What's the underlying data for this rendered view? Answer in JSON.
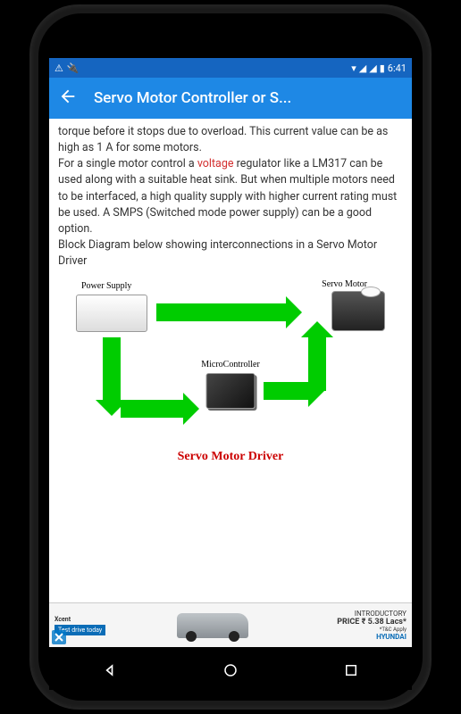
{
  "status": {
    "time": "6:41"
  },
  "appbar": {
    "title": "Servo Motor Controller or S..."
  },
  "content": {
    "p1": "torque before it stops due to overload. This current value can be as high as 1 A for some motors.",
    "p2a": "For a single motor control a ",
    "voltage_link": "voltage",
    "p2b": " regulator like a LM317 can be used along with a suitable heat sink. But when multiple motors need to be interfaced, a high quality supply with higher current rating must be used. A SMPS (Switched mode power supply) can be a good option.",
    "p3": "Block Diagram below showing interconnections in a Servo Motor Driver"
  },
  "diagram": {
    "power_supply": "Power Supply",
    "servo_motor": "Servo Motor",
    "microcontroller": "MicroController",
    "title": "Servo Motor Driver"
  },
  "ad": {
    "brand_top": "Xcent",
    "cta": "Test drive today",
    "intro": "INTRODUCTORY",
    "price": "PRICE ₹ 5.38 Lacs*",
    "terms": "*T&C Apply",
    "brand": "HYUNDAI"
  }
}
